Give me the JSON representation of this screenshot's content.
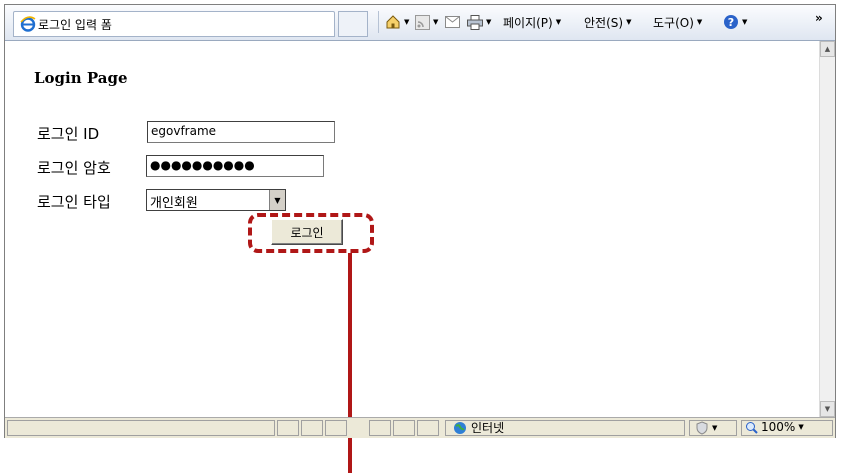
{
  "browser": {
    "tab_title": "로그인 입력 폼",
    "menu": {
      "page": "페이지(P)",
      "safety": "안전(S)",
      "tools": "도구(O)",
      "more": "»"
    }
  },
  "page": {
    "heading": "Login Page",
    "fields": {
      "id_label": "로그인 ID",
      "id_value": "egovframe",
      "password_label": "로그인 암호",
      "password_mask": "●●●●●●●●●●",
      "type_label": "로그인 타입",
      "type_value": "개인회원"
    },
    "login_button": "로그인"
  },
  "status": {
    "zone": "인터넷",
    "zoom": "100%"
  },
  "colors": {
    "annotation": "#b01717"
  }
}
